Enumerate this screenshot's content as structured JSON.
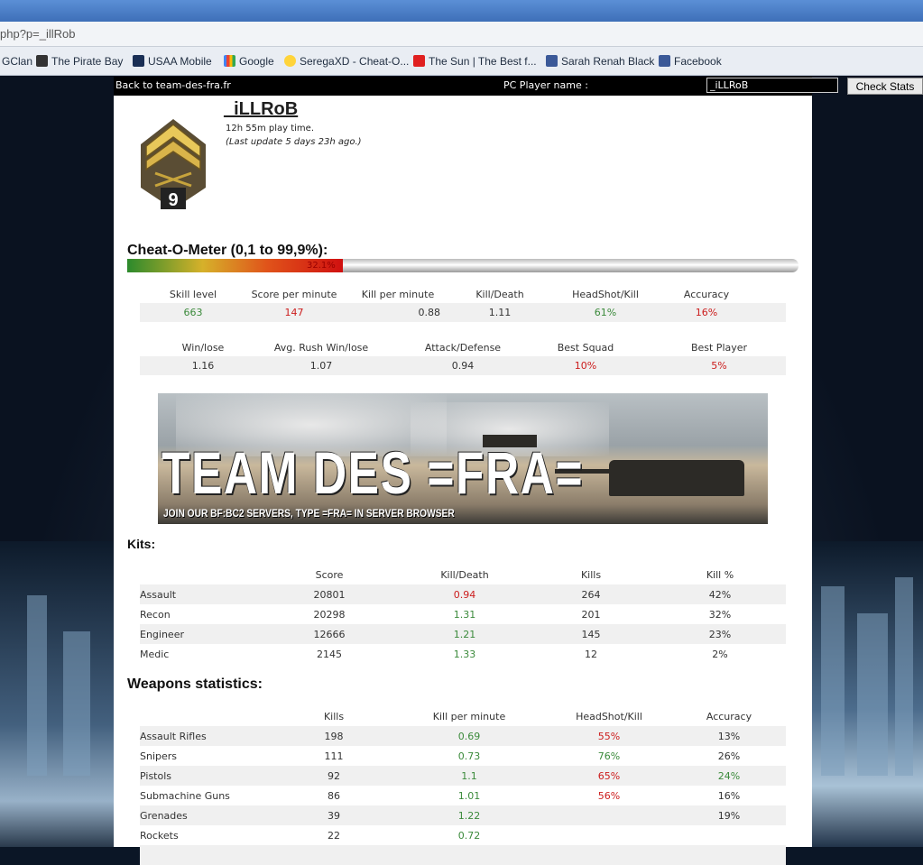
{
  "browser": {
    "url": "php?p=_illRob",
    "bookmarks": [
      "GClan",
      "The Pirate Bay",
      "USAA Mobile",
      "Google",
      "SeregaXD - Cheat-O...",
      "The Sun | The Best f...",
      "Sarah Renah Black",
      "Facebook"
    ]
  },
  "topbar": {
    "back_link": "Back to team-des-fra.fr",
    "player_label": "PC Player name :",
    "player_value": "_iLLRoB",
    "check_button": "Check Stats"
  },
  "player": {
    "rank": "9",
    "name": "_iLLRoB",
    "playtime": "12h 55m play time.",
    "last_update": "(Last update 5 days 23h ago.)"
  },
  "cheat_meter": {
    "title": "Cheat-O-Meter (0,1 to 99,9%):",
    "value_label": "32.1%",
    "value_percent": 32.1
  },
  "stats1": {
    "headers": [
      "Skill level",
      "Score per minute",
      "Kill per minute",
      "Kill/Death",
      "HeadShot/Kill",
      "Accuracy"
    ],
    "values": [
      "663",
      "147",
      "0.88",
      "1.11",
      "61%",
      "16%"
    ]
  },
  "stats2": {
    "headers": [
      "Win/lose",
      "Avg. Rush Win/lose",
      "Attack/Defense",
      "Best Squad",
      "Best Player"
    ],
    "values": [
      "1.16",
      "1.07",
      "0.94",
      "10%",
      "5%"
    ]
  },
  "banner": {
    "title": "TEAM DES =FRA=",
    "subtitle": "JOIN OUR BF:BC2 SERVERS, TYPE =FRA= IN SERVER BROWSER"
  },
  "kits": {
    "title": "Kits:",
    "headers": [
      "Score",
      "Kill/Death",
      "Kills",
      "Kill %"
    ],
    "rows": [
      [
        "Assault",
        "20801",
        "0.94",
        "264",
        "42%"
      ],
      [
        "Recon",
        "20298",
        "1.31",
        "201",
        "32%"
      ],
      [
        "Engineer",
        "12666",
        "1.21",
        "145",
        "23%"
      ],
      [
        "Medic",
        "2145",
        "1.33",
        "12",
        "2%"
      ]
    ]
  },
  "weapons": {
    "title": "Weapons statistics:",
    "headers": [
      "Kills",
      "Kill per minute",
      "HeadShot/Kill",
      "Accuracy"
    ],
    "rows": [
      [
        "Assault Rifles",
        "198",
        "0.69",
        "55%",
        "13%"
      ],
      [
        "Snipers",
        "111",
        "0.73",
        "76%",
        "26%"
      ],
      [
        "Pistols",
        "92",
        "1.1",
        "65%",
        "24%"
      ],
      [
        "Submachine Guns",
        "86",
        "1.01",
        "56%",
        "16%"
      ],
      [
        "Grenades",
        "39",
        "1.22",
        "",
        "19%"
      ],
      [
        "Rockets",
        "22",
        "0.72",
        "",
        ""
      ]
    ]
  }
}
